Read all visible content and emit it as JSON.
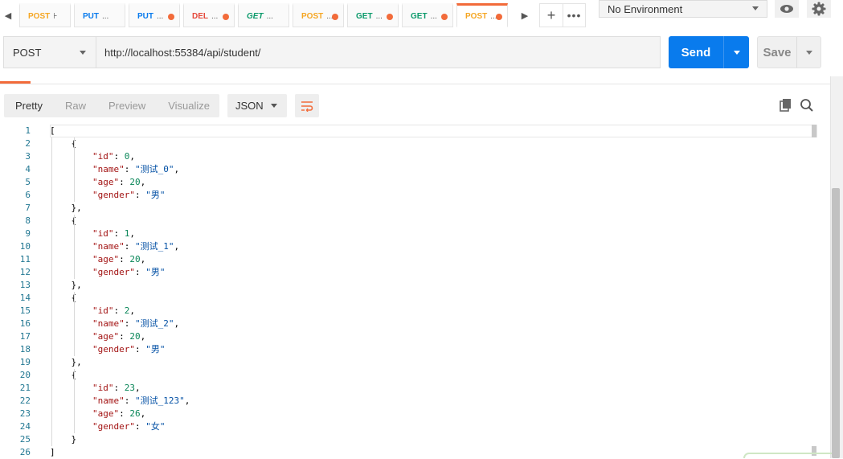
{
  "tabs": [
    {
      "method": "POST",
      "suffix": "⊦",
      "color": "#f5a623",
      "italic": false,
      "dot": false,
      "active": false
    },
    {
      "method": "PUT",
      "suffix": "...",
      "color": "#097bed",
      "italic": false,
      "dot": false,
      "active": false
    },
    {
      "method": "PUT",
      "suffix": "...",
      "color": "#097bed",
      "italic": false,
      "dot": true,
      "active": false
    },
    {
      "method": "DEL",
      "suffix": "...",
      "color": "#e5483a",
      "italic": false,
      "dot": true,
      "active": false
    },
    {
      "method": "GET",
      "suffix": "...",
      "color": "#0b9a6b",
      "italic": true,
      "dot": false,
      "active": false
    },
    {
      "method": "POST",
      "suffix": "...",
      "color": "#f5a623",
      "italic": false,
      "dot": true,
      "active": false
    },
    {
      "method": "GET",
      "suffix": "...",
      "color": "#0b9a6b",
      "italic": false,
      "dot": true,
      "active": false
    },
    {
      "method": "GET",
      "suffix": "...",
      "color": "#0b9a6b",
      "italic": false,
      "dot": true,
      "active": false
    },
    {
      "method": "POST",
      "suffix": "...",
      "color": "#f5a623",
      "italic": false,
      "dot": true,
      "active": true
    }
  ],
  "tab_actions": {
    "add": "+",
    "more": "•••"
  },
  "environment": {
    "label": "No Environment"
  },
  "request": {
    "method": "POST",
    "url": "http://localhost:55384/api/student/",
    "send_label": "Send",
    "save_label": "Save"
  },
  "response_toolbar": {
    "view_tabs": [
      "Pretty",
      "Raw",
      "Preview",
      "Visualize"
    ],
    "active_view": "Pretty",
    "format": "JSON"
  },
  "colors": {
    "accent": "#f26b3a",
    "send": "#097bed",
    "line_number": "#237893",
    "json_key": "#a31515",
    "json_string": "#0451a5",
    "json_number": "#098658"
  },
  "response_lines": [
    [
      {
        "t": "p",
        "v": "["
      }
    ],
    [
      {
        "t": "p",
        "v": "    {"
      }
    ],
    [
      {
        "t": "p",
        "v": "        "
      },
      {
        "t": "k",
        "v": "\"id\""
      },
      {
        "t": "p",
        "v": ": "
      },
      {
        "t": "n",
        "v": "0"
      },
      {
        "t": "p",
        "v": ","
      }
    ],
    [
      {
        "t": "p",
        "v": "        "
      },
      {
        "t": "k",
        "v": "\"name\""
      },
      {
        "t": "p",
        "v": ": "
      },
      {
        "t": "s",
        "v": "\"测试_0\""
      },
      {
        "t": "p",
        "v": ","
      }
    ],
    [
      {
        "t": "p",
        "v": "        "
      },
      {
        "t": "k",
        "v": "\"age\""
      },
      {
        "t": "p",
        "v": ": "
      },
      {
        "t": "n",
        "v": "20"
      },
      {
        "t": "p",
        "v": ","
      }
    ],
    [
      {
        "t": "p",
        "v": "        "
      },
      {
        "t": "k",
        "v": "\"gender\""
      },
      {
        "t": "p",
        "v": ": "
      },
      {
        "t": "s",
        "v": "\"男\""
      }
    ],
    [
      {
        "t": "p",
        "v": "    },"
      }
    ],
    [
      {
        "t": "p",
        "v": "    {"
      }
    ],
    [
      {
        "t": "p",
        "v": "        "
      },
      {
        "t": "k",
        "v": "\"id\""
      },
      {
        "t": "p",
        "v": ": "
      },
      {
        "t": "n",
        "v": "1"
      },
      {
        "t": "p",
        "v": ","
      }
    ],
    [
      {
        "t": "p",
        "v": "        "
      },
      {
        "t": "k",
        "v": "\"name\""
      },
      {
        "t": "p",
        "v": ": "
      },
      {
        "t": "s",
        "v": "\"测试_1\""
      },
      {
        "t": "p",
        "v": ","
      }
    ],
    [
      {
        "t": "p",
        "v": "        "
      },
      {
        "t": "k",
        "v": "\"age\""
      },
      {
        "t": "p",
        "v": ": "
      },
      {
        "t": "n",
        "v": "20"
      },
      {
        "t": "p",
        "v": ","
      }
    ],
    [
      {
        "t": "p",
        "v": "        "
      },
      {
        "t": "k",
        "v": "\"gender\""
      },
      {
        "t": "p",
        "v": ": "
      },
      {
        "t": "s",
        "v": "\"男\""
      }
    ],
    [
      {
        "t": "p",
        "v": "    },"
      }
    ],
    [
      {
        "t": "p",
        "v": "    {"
      }
    ],
    [
      {
        "t": "p",
        "v": "        "
      },
      {
        "t": "k",
        "v": "\"id\""
      },
      {
        "t": "p",
        "v": ": "
      },
      {
        "t": "n",
        "v": "2"
      },
      {
        "t": "p",
        "v": ","
      }
    ],
    [
      {
        "t": "p",
        "v": "        "
      },
      {
        "t": "k",
        "v": "\"name\""
      },
      {
        "t": "p",
        "v": ": "
      },
      {
        "t": "s",
        "v": "\"测试_2\""
      },
      {
        "t": "p",
        "v": ","
      }
    ],
    [
      {
        "t": "p",
        "v": "        "
      },
      {
        "t": "k",
        "v": "\"age\""
      },
      {
        "t": "p",
        "v": ": "
      },
      {
        "t": "n",
        "v": "20"
      },
      {
        "t": "p",
        "v": ","
      }
    ],
    [
      {
        "t": "p",
        "v": "        "
      },
      {
        "t": "k",
        "v": "\"gender\""
      },
      {
        "t": "p",
        "v": ": "
      },
      {
        "t": "s",
        "v": "\"男\""
      }
    ],
    [
      {
        "t": "p",
        "v": "    },"
      }
    ],
    [
      {
        "t": "p",
        "v": "    {"
      }
    ],
    [
      {
        "t": "p",
        "v": "        "
      },
      {
        "t": "k",
        "v": "\"id\""
      },
      {
        "t": "p",
        "v": ": "
      },
      {
        "t": "n",
        "v": "23"
      },
      {
        "t": "p",
        "v": ","
      }
    ],
    [
      {
        "t": "p",
        "v": "        "
      },
      {
        "t": "k",
        "v": "\"name\""
      },
      {
        "t": "p",
        "v": ": "
      },
      {
        "t": "s",
        "v": "\"测试_123\""
      },
      {
        "t": "p",
        "v": ","
      }
    ],
    [
      {
        "t": "p",
        "v": "        "
      },
      {
        "t": "k",
        "v": "\"age\""
      },
      {
        "t": "p",
        "v": ": "
      },
      {
        "t": "n",
        "v": "26"
      },
      {
        "t": "p",
        "v": ","
      }
    ],
    [
      {
        "t": "p",
        "v": "        "
      },
      {
        "t": "k",
        "v": "\"gender\""
      },
      {
        "t": "p",
        "v": ": "
      },
      {
        "t": "s",
        "v": "\"女\""
      }
    ],
    [
      {
        "t": "p",
        "v": "    }"
      }
    ],
    [
      {
        "t": "p",
        "v": "]"
      }
    ]
  ]
}
